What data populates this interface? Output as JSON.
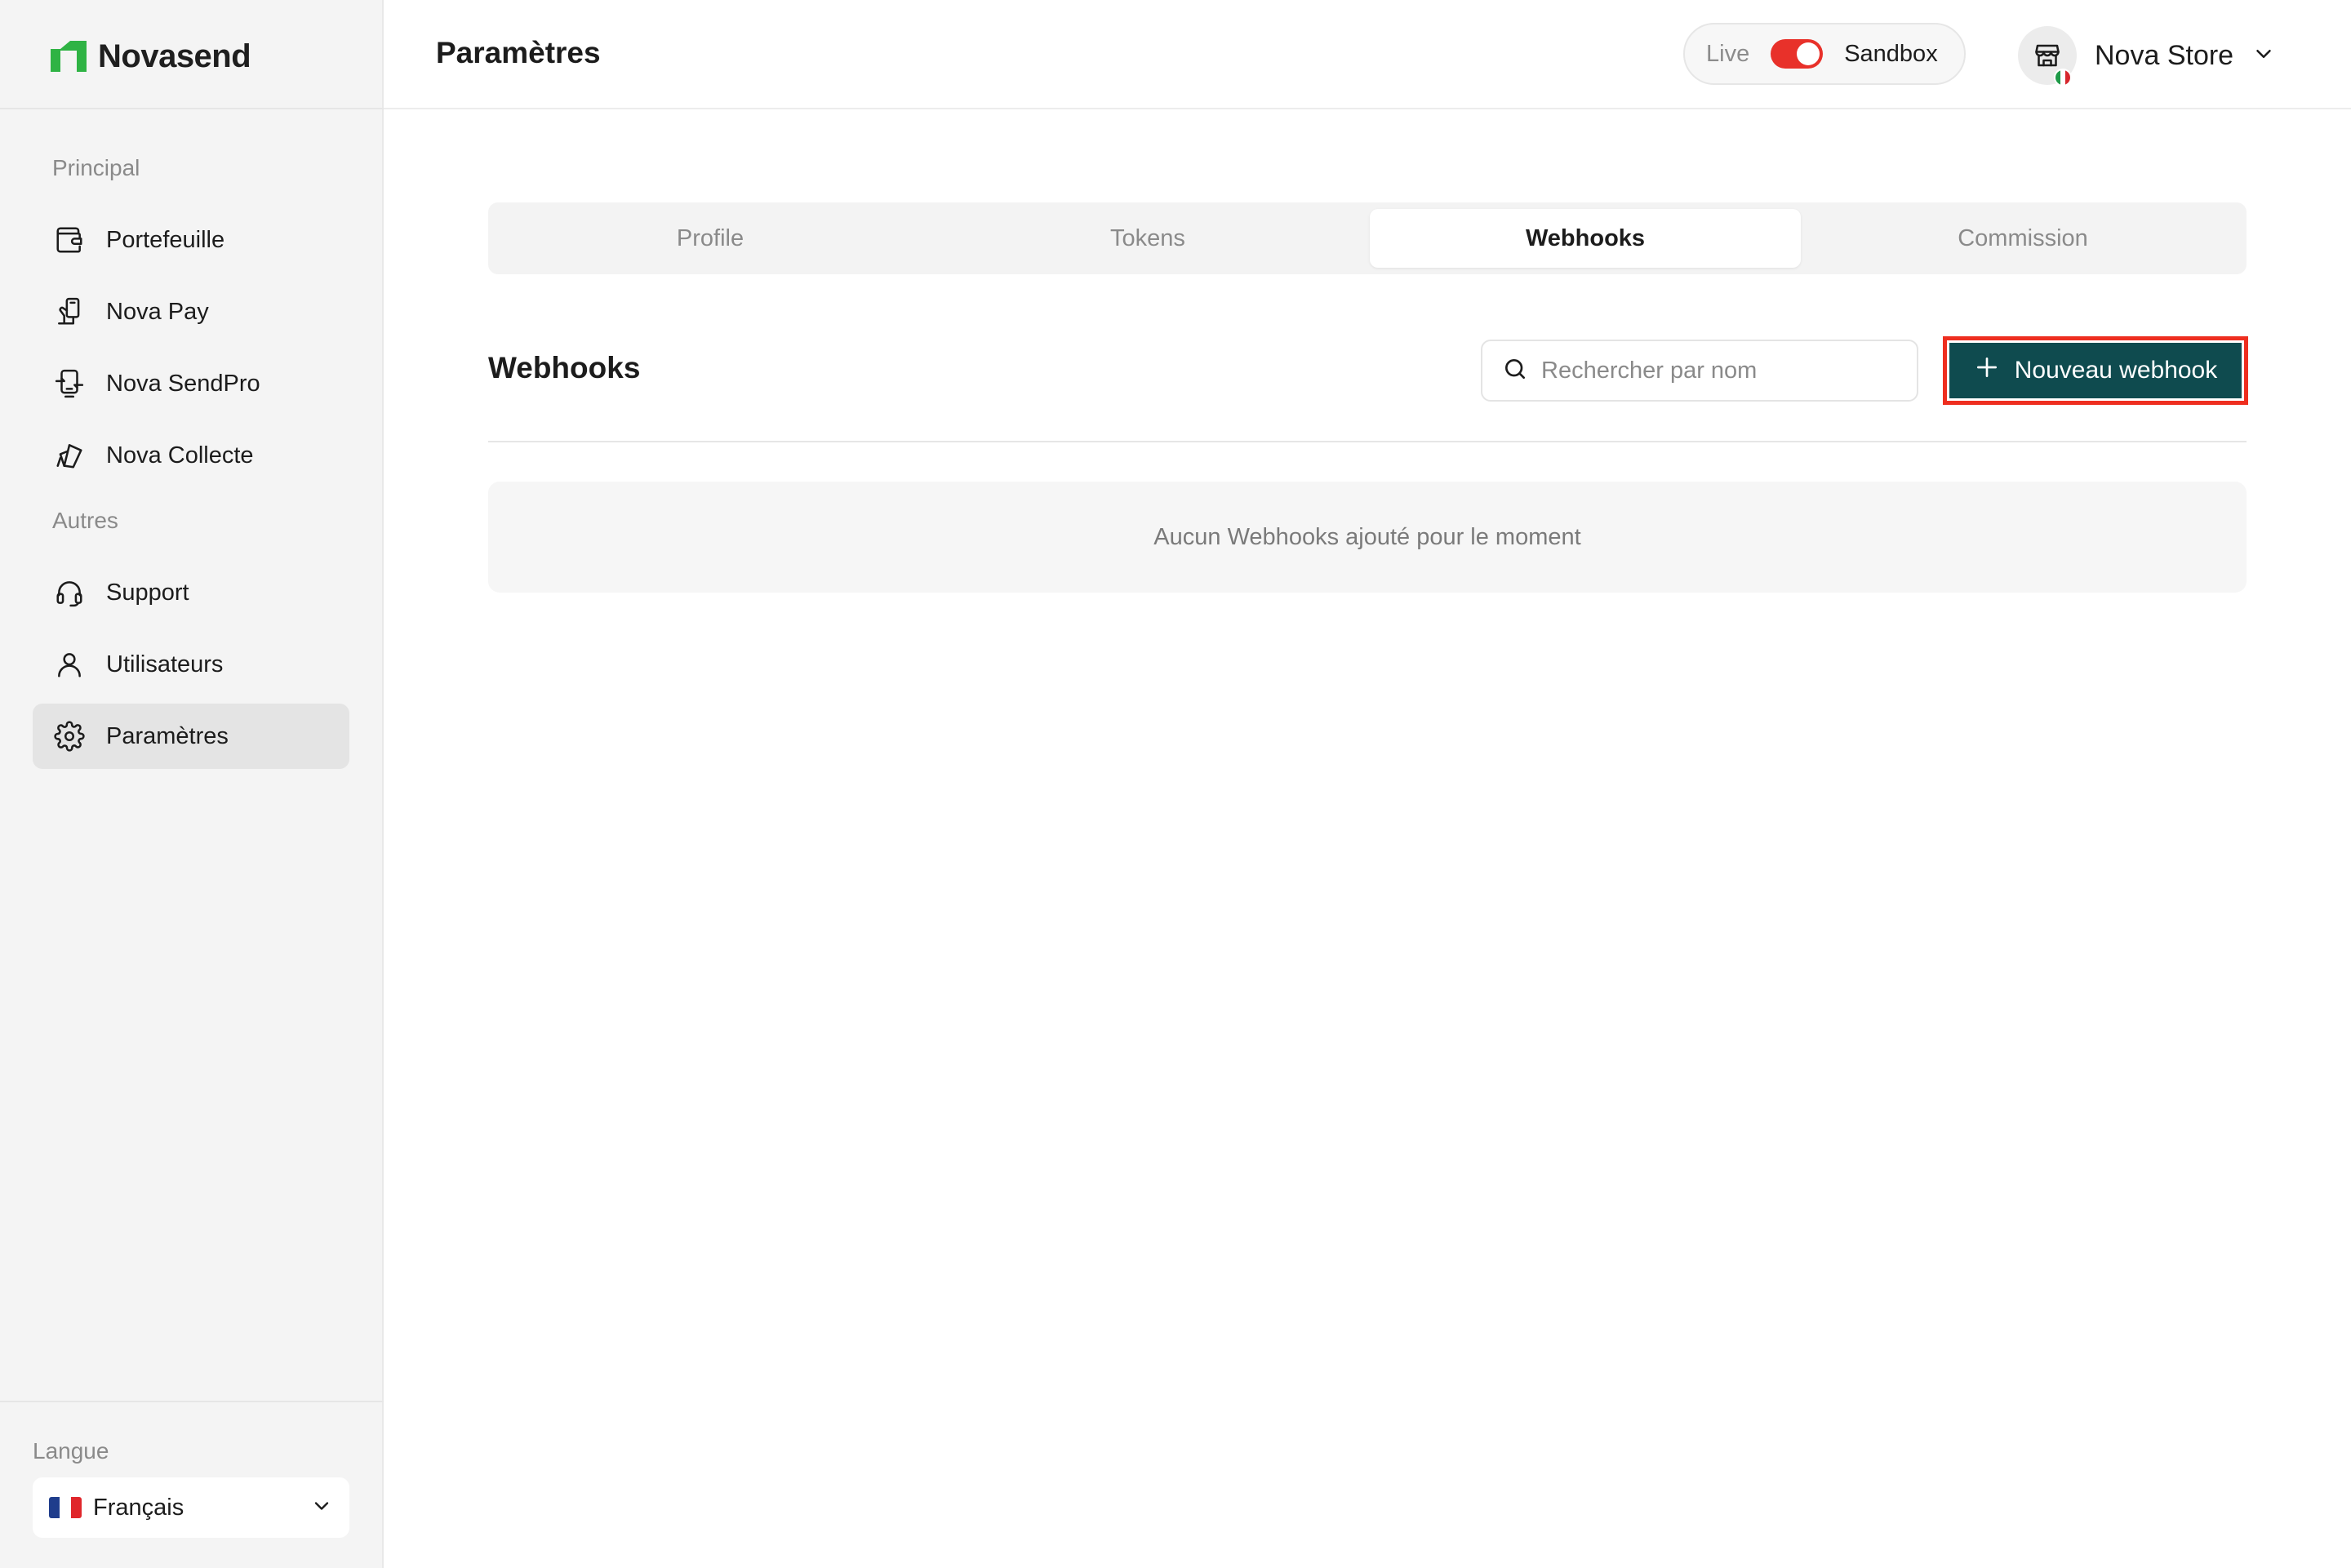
{
  "app": {
    "name": "Novasend",
    "brand_color": "#2fb344"
  },
  "sidebar": {
    "sections": [
      {
        "label": "Principal"
      },
      {
        "label": "Autres"
      }
    ],
    "items": [
      {
        "label": "Portefeuille",
        "icon": "wallet-icon"
      },
      {
        "label": "Nova Pay",
        "icon": "hand-phone-icon"
      },
      {
        "label": "Nova SendPro",
        "icon": "transfer-icon"
      },
      {
        "label": "Nova Collecte",
        "icon": "cards-icon"
      },
      {
        "label": "Support",
        "icon": "headset-icon"
      },
      {
        "label": "Utilisateurs",
        "icon": "user-icon"
      },
      {
        "label": "Paramètres",
        "icon": "gear-icon",
        "active": true
      }
    ],
    "language": {
      "label": "Langue",
      "selected": "Français"
    }
  },
  "header": {
    "title": "Paramètres",
    "env": {
      "live": "Live",
      "sandbox": "Sandbox",
      "toggle_color": "#e8312a"
    },
    "store": {
      "name": "Nova Store",
      "icon": "store-icon"
    }
  },
  "tabs": [
    {
      "label": "Profile"
    },
    {
      "label": "Tokens"
    },
    {
      "label": "Webhooks",
      "active": true
    },
    {
      "label": "Commission"
    }
  ],
  "main": {
    "section_title": "Webhooks",
    "search": {
      "placeholder": "Rechercher par nom",
      "value": ""
    },
    "new_button": {
      "label": "Nouveau webhook",
      "color": "#0f4b4f"
    },
    "empty_state": "Aucun Webhooks ajouté pour le moment"
  }
}
